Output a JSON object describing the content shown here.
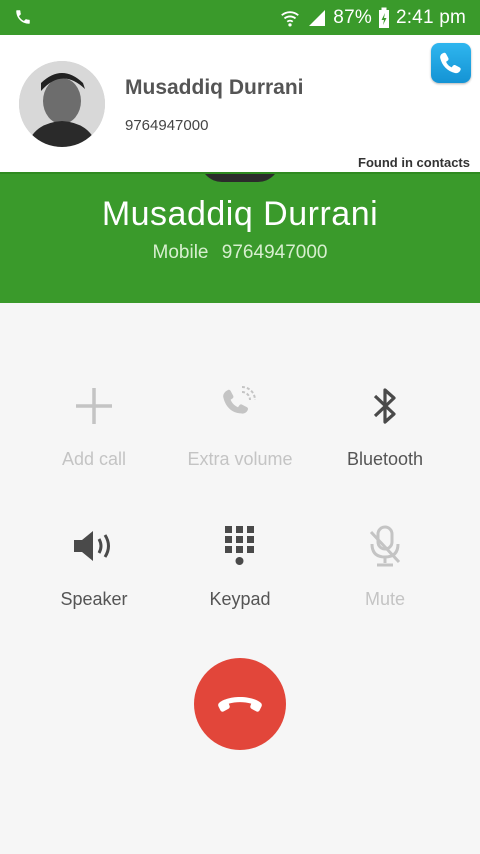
{
  "status_bar": {
    "battery": "87%",
    "time": "2:41 pm",
    "icons": [
      "phone-call-icon",
      "wifi-calling-icon",
      "signal-icon",
      "battery-charging-icon"
    ]
  },
  "call": {
    "name": "Musaddiq Durrani",
    "label": "Mobile",
    "number": "9764947000"
  },
  "popup": {
    "name": "Musaddiq Durrani",
    "number": "9764947000",
    "found_text": "Found in contacts"
  },
  "controls": [
    {
      "label": "Add call",
      "icon": "plus-icon",
      "enabled": false
    },
    {
      "label": "Extra volume",
      "icon": "extra-volume-icon",
      "enabled": false
    },
    {
      "label": "Bluetooth",
      "icon": "bluetooth-icon",
      "enabled": true
    },
    {
      "label": "Speaker",
      "icon": "speaker-icon",
      "enabled": true
    },
    {
      "label": "Keypad",
      "icon": "keypad-icon",
      "enabled": true
    },
    {
      "label": "Mute",
      "icon": "mute-icon",
      "enabled": false
    }
  ],
  "colors": {
    "green": "#3a9a2b",
    "end_call_red": "#e2463a",
    "disabled_grey": "#c4c4c4"
  }
}
